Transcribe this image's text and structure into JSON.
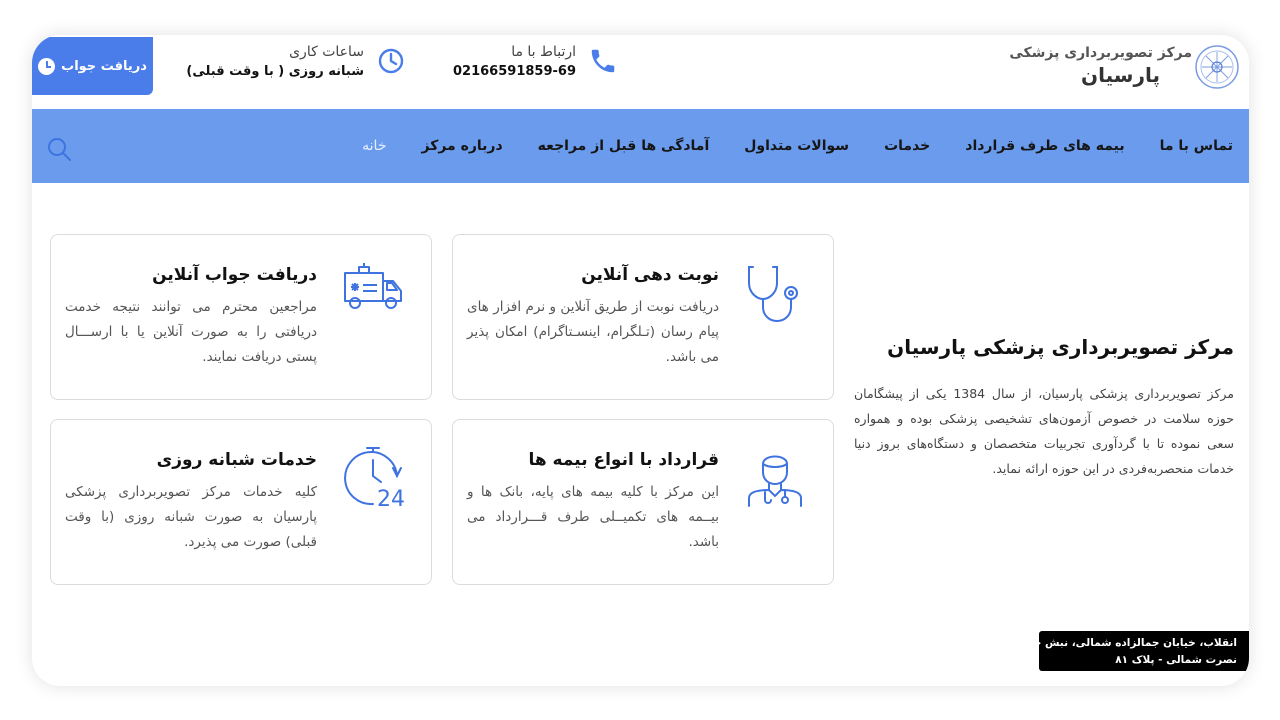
{
  "header": {
    "cta_button_label": "دریافت جواب",
    "hours_label": "ساعات کاری",
    "hours_value": "شبانه روزی ( با وقت قبلی)",
    "contact_label": "ارتباط با ما",
    "contact_phone": "02166591859-69",
    "logo_line1": "مرکز تصویربرداری پزشکی",
    "logo_line2": "پارسیان"
  },
  "nav": {
    "items": [
      {
        "label": "خانه",
        "active": true
      },
      {
        "label": "درباره مرکز",
        "active": false
      },
      {
        "label": "آمادگی ها قبل از مراجعه",
        "active": false
      },
      {
        "label": "سوالات متداول",
        "active": false
      },
      {
        "label": "خدمات",
        "active": false
      },
      {
        "label": "بیمه های طرف قرارداد",
        "active": false
      },
      {
        "label": "تماس با ما",
        "active": false
      }
    ]
  },
  "about": {
    "title": "مرکز تصویربرداری پزشکی پارسیان",
    "body": "مرکز تصویربرداری پزشکی پارسیان، از سال 1384 یکی از پیشگامان حوزه سلامت در خصوص آزمون‌های تشخیصی پزشکی بوده و همواره سعی نموده تا با گردآوری تجربیات متخصصان و دستگاه‌های بروز دنیا خدمات منحصربه‌فردی در این حوزه ارائه نماید."
  },
  "cards": [
    {
      "title": "نوبت دهی آنلاین",
      "text": "دریافت نوبت از طریق آنلاین و نرم افزار های پیام رسان (تـلگرام، اینسـتاگرام) امکان پذیر می باشد.",
      "icon": "stethoscope-icon"
    },
    {
      "title": "دریافت جواب آنلاین",
      "text": "مراجعین محترم می توانند نتیجه خدمت دریافتی را به صورت آنلاین یا با ارســـال پستی دریافت نمایند.",
      "icon": "ambulance-icon"
    },
    {
      "title": "قرارداد با انواع بیمه ها",
      "text": "این مرکز با کلیه بیمه های پایه، بانک ها و بیــمه های تکمیــلی طرف قـــرارداد می باشد.",
      "icon": "doctor-icon"
    },
    {
      "title": "خدمات شبانه روزی",
      "text": "کلیه خدمات مرکز تصویربرداری پزشکی پارسیان به صورت شبانه روزی (با وقت قبلی) صورت می پذیرد.",
      "icon": "clock-24-icon"
    }
  ],
  "address": {
    "line1": "انقلاب، خیابان جمالزاده شمالی، نبش چهارراه",
    "line2": "نصرت شمالی - پلاک ۸۱"
  },
  "colors": {
    "accent": "#4a7de9",
    "nav_background": "#6a9bed",
    "icon_blue": "#3f73e0"
  }
}
